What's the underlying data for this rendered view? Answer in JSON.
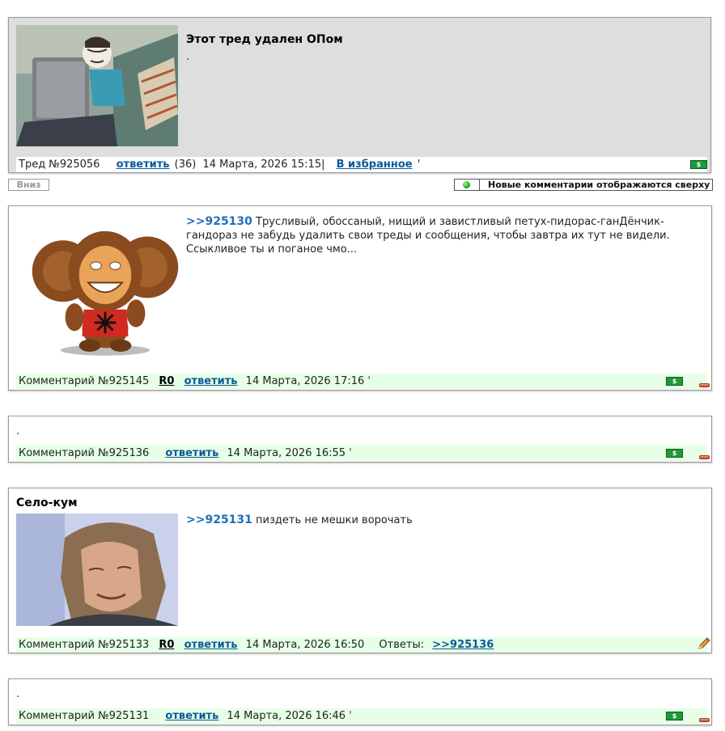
{
  "thread": {
    "title": "Этот тред удален ОПом",
    "text": ".",
    "number": "Тред №925056",
    "reply_label": "ответить",
    "reply_count": "(36)",
    "date": "14 Марта, 2026 15:15|",
    "favorite_label": "В избранное",
    "tick": "'"
  },
  "controls": {
    "down_label": "Вниз",
    "new_comments_label": "Новые комментарии отображаются сверху"
  },
  "comments": [
    {
      "ref": ">>925130",
      "text": " Трусливый, обоссаный, нищий и завистливый петух-пидорас-ганДёнчик-гандораз не забудь удалить свои треды и сообщения, чтобы завтра их тут не видели. Ссыкливое ты и поганое чмо...",
      "number": "Комментарий №925145",
      "r0": "R0",
      "reply_label": "ответить",
      "date": "14 Марта, 2026 17:16",
      "tick": "'"
    },
    {
      "text": ".",
      "number": "Комментарий №925136",
      "reply_label": "ответить",
      "date": "14 Марта, 2026 16:55",
      "tick": "'"
    },
    {
      "author": "Село-кум",
      "ref": ">>925131",
      "text": " пиздеть не мешки ворочать",
      "number": "Комментарий №925133",
      "r0": "R0",
      "reply_label": "ответить",
      "date": "14 Марта, 2026 16:50",
      "answers_label": "Ответы:",
      "answers_ref": ">>925136"
    },
    {
      "text": ".",
      "number": "Комментарий №925131",
      "reply_label": "ответить",
      "date": "14 Марта, 2026 16:46",
      "tick": "'"
    }
  ],
  "icons": {
    "money": "money-icon",
    "minus": "minus-icon",
    "pencil": "pencil-icon",
    "status_dot": "green-dot-icon"
  },
  "colors": {
    "thread_bg": "#dedede",
    "comment_bar_bg": "#e6ffe6",
    "link": "#0a5a9c",
    "ref": "#1f6fb3",
    "money": "#1f9a3a"
  }
}
